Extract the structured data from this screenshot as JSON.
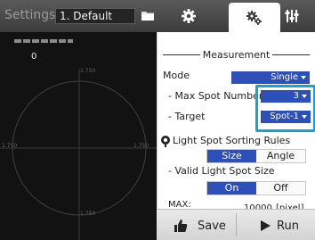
{
  "header": {
    "title": "Settings",
    "preset": "1. Default",
    "icons": [
      "folder-icon",
      "gear-icon",
      "gears-icon",
      "sliders-icon"
    ]
  },
  "display": {
    "value": "0",
    "ticks": {
      "top": "1.750",
      "bottom": "1.750",
      "left": "1.750",
      "right": "1.750"
    }
  },
  "settings": {
    "section_title": "Measurement",
    "mode_label": "Mode",
    "mode_value": "Single",
    "max_spot_label": "- Max Spot Number",
    "max_spot_value": "3",
    "target_label": "- Target",
    "target_value": "Spot-1",
    "sorting_title": "Light Spot Sorting Rules",
    "sort_options": [
      "Size",
      "Angle"
    ],
    "sort_selected": "Size",
    "valid_size_label": "- Valid Light Spot Size",
    "valid_options": [
      "On",
      "Off"
    ],
    "valid_selected": "On",
    "max_label": "MAX:",
    "max_value": "10000",
    "max_unit": "[pixel]"
  },
  "footer": {
    "save_label": "Save",
    "run_label": "Run"
  },
  "colors": {
    "accent": "#2c4fb8",
    "highlight": "#11a4dc",
    "topbar": "#4a4a4a",
    "display_bg": "#121212"
  }
}
